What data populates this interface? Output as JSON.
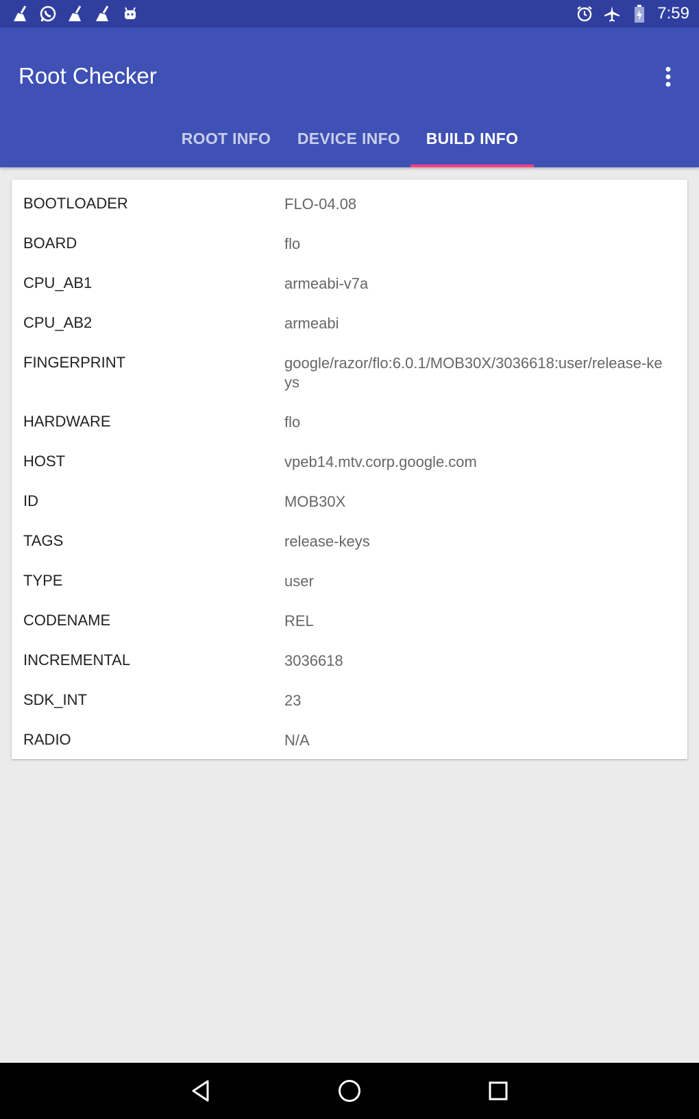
{
  "status_bar": {
    "time": "7:59",
    "left_icons": [
      "broom-icon",
      "whatsapp-icon",
      "broom-icon",
      "broom-icon",
      "android-icon"
    ],
    "right_icons": [
      "alarm-icon",
      "airplane-icon",
      "battery-charging-icon"
    ]
  },
  "app_bar": {
    "title": "Root Checker",
    "tabs": [
      {
        "label": "ROOT INFO",
        "active": false
      },
      {
        "label": "DEVICE INFO",
        "active": false
      },
      {
        "label": "BUILD INFO",
        "active": true
      }
    ]
  },
  "build_info": [
    {
      "key": "BOOTLOADER",
      "value": "FLO-04.08"
    },
    {
      "key": "BOARD",
      "value": "flo"
    },
    {
      "key": "CPU_AB1",
      "value": "armeabi-v7a"
    },
    {
      "key": "CPU_AB2",
      "value": "armeabi"
    },
    {
      "key": "FINGERPRINT",
      "value": "google/razor/flo:6.0.1/MOB30X/3036618:user/release-keys"
    },
    {
      "key": "HARDWARE",
      "value": "flo"
    },
    {
      "key": "HOST",
      "value": "vpeb14.mtv.corp.google.com"
    },
    {
      "key": "ID",
      "value": "MOB30X"
    },
    {
      "key": "TAGS",
      "value": "release-keys"
    },
    {
      "key": "TYPE",
      "value": "user"
    },
    {
      "key": "CODENAME",
      "value": "REL"
    },
    {
      "key": "INCREMENTAL",
      "value": "3036618"
    },
    {
      "key": "SDK_INT",
      "value": "23"
    },
    {
      "key": "RADIO",
      "value": "N/A"
    }
  ],
  "colors": {
    "status_bar": "#303f9f",
    "primary": "#3f51b5",
    "accent": "#ff4081",
    "background": "#ebebeb"
  }
}
